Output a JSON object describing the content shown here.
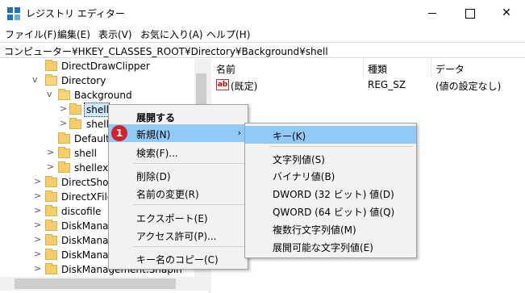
{
  "window": {
    "title": "レジストリ エディター",
    "minimize": "",
    "maximize": "",
    "close": "✕"
  },
  "menu": [
    "ファイル(F)",
    "編集(E)",
    "表示(V)",
    "お気に入り(A)",
    "ヘルプ(H)"
  ],
  "address": "コンピューター¥HKEY_CLASSES_ROOT¥Directory¥Background¥shell",
  "tree": [
    {
      "label": "DirectDrawClipper"
    },
    {
      "label": "Directory",
      "chevron": "v"
    },
    {
      "label": "Background",
      "chevron": "v"
    },
    {
      "label": "shell",
      "chevron": ">"
    },
    {
      "label": "shellex",
      "chevron": ">"
    },
    {
      "label": "DefaultIcon"
    },
    {
      "label": "shell",
      "chevron": ">"
    },
    {
      "label": "shellex",
      "chevron": ">"
    },
    {
      "label": "DirectShow",
      "chevron": ">"
    },
    {
      "label": "DirectXFile",
      "chevron": ">"
    },
    {
      "label": "discofile",
      "chevron": ">"
    },
    {
      "label": "DiskManag",
      "chevron": ">"
    },
    {
      "label": "DiskManag",
      "chevron": ">"
    },
    {
      "label": "DiskManag",
      "chevron": ">"
    },
    {
      "label": "DiskManagement.Snapin",
      "chevron": ">"
    }
  ],
  "list": {
    "headers": [
      "名前",
      "種類",
      "データ"
    ],
    "rows": [
      {
        "name": "(既定)",
        "type": "REG_SZ",
        "data": "(値の設定なし)"
      }
    ]
  },
  "context_menu": [
    {
      "label": "展開する"
    },
    {
      "label": "新規(N)",
      "arrow": "›"
    },
    {
      "label": "検索(F)..."
    },
    {
      "label": "削除(D)"
    },
    {
      "label": "名前の変更(R)"
    },
    {
      "label": "エクスポート(E)"
    },
    {
      "label": "アクセス許可(P)..."
    },
    {
      "label": "キー名のコピー(C)"
    }
  ],
  "submenu": [
    "キー(K)",
    "文字列値(S)",
    "バイナリ値(B)",
    "DWORD (32 ビット) 値(D)",
    "QWORD (64 ビット) 値(Q)",
    "複数行文字列値(M)",
    "展開可能な文字列値(E)"
  ],
  "badge": "1",
  "colors": {
    "highlight": "#91c9f7",
    "badge": "#d4202a",
    "folder": "#f4ce6a"
  },
  "icons": [
    "registry-app-icon",
    "folder-icon",
    "string-value-icon",
    "chevron-right-icon",
    "chevron-down-icon"
  ]
}
